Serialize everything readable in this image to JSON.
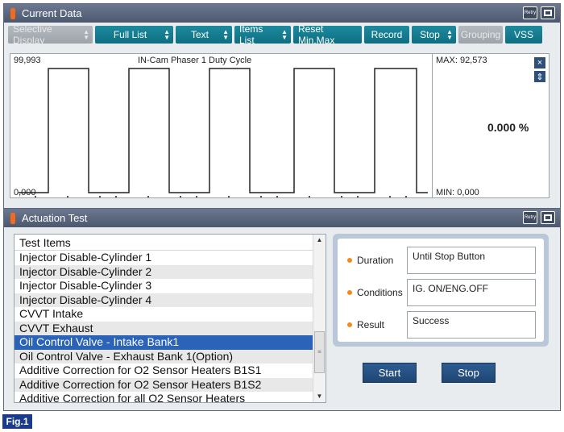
{
  "current_data": {
    "title": "Current Data",
    "retry_label": "Retry",
    "toolbar": [
      {
        "label": "Selective Display",
        "disabled": true,
        "spinner": true
      },
      {
        "label": "Full List",
        "disabled": false,
        "spinner": true
      },
      {
        "label": "Text",
        "disabled": false,
        "spinner": true
      },
      {
        "label": "Items List",
        "disabled": false,
        "spinner": true
      },
      {
        "label": "Reset Min.Max",
        "disabled": false,
        "spinner": false
      },
      {
        "label": "Record",
        "disabled": false,
        "spinner": false
      },
      {
        "label": "Stop",
        "disabled": false,
        "spinner": true
      },
      {
        "label": "Grouping",
        "disabled": true,
        "spinner": false
      },
      {
        "label": "VSS",
        "disabled": false,
        "spinner": false
      }
    ],
    "graph": {
      "title": "IN-Cam Phaser 1 Duty Cycle",
      "y_top_label": "99,993",
      "y_bottom_label": "0,000",
      "max_label": "MAX: 92,573",
      "min_label": "MIN: 0,000",
      "current_value": "0.000 %"
    }
  },
  "actuation_test": {
    "title": "Actuation Test",
    "retry_label": "Retry",
    "list_header": "Test Items",
    "items": [
      "Injector Disable-Cylinder 1",
      "Injector Disable-Cylinder 2",
      "Injector Disable-Cylinder 3",
      "Injector Disable-Cylinder 4",
      "CVVT Intake",
      "CVVT Exhaust",
      "Oil Control Valve - Intake Bank1",
      "Oil Control Valve - Exhaust Bank 1(Option)",
      "Additive Correction for O2 Sensor Heaters B1S1",
      "Additive Correction for O2 Sensor Heaters B1S2",
      "Additive Correction for all O2 Sensor Heaters"
    ],
    "selected_index": 6,
    "duration_label": "Duration",
    "duration_value": "Until Stop Button",
    "conditions_label": "Conditions",
    "conditions_value": "IG. ON/ENG.OFF",
    "result_label": "Result",
    "result_value": "Success",
    "start_label": "Start",
    "stop_label": "Stop"
  },
  "figure_label": "Fig.1",
  "colors": {
    "accent": "#1c8a9e",
    "titlebar": "#5a6680",
    "selection": "#2a63b8",
    "button": "#2e5d93"
  }
}
